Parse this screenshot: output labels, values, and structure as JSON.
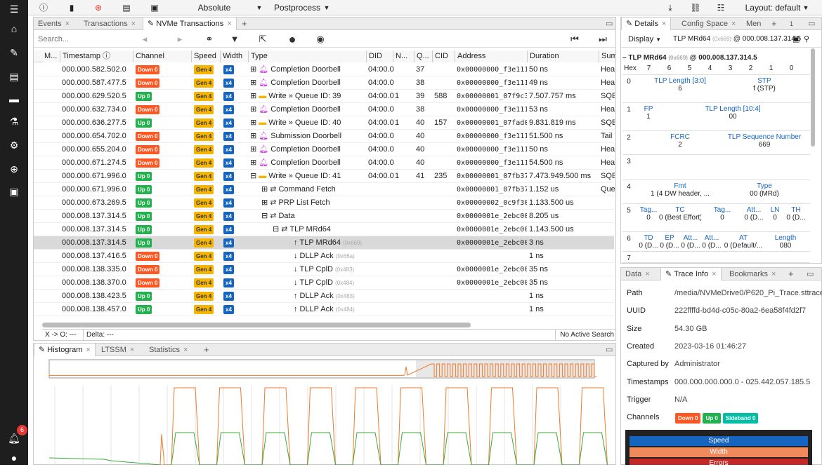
{
  "topbar": {
    "display_mode": "Absolute (Formatted)",
    "postprocess": "Postprocess",
    "layout": "Layout: default"
  },
  "sidebar": {
    "notification_count": "6"
  },
  "main_tabs": [
    {
      "label": "Events"
    },
    {
      "label": "Transactions"
    },
    {
      "label": "NVMe Transactions"
    }
  ],
  "toolbar": {
    "search_placeholder": "Search..."
  },
  "columns": [
    "M...",
    "Timestamp",
    "Channel",
    "Speed",
    "Width",
    "Type",
    "DID",
    "N...",
    "Q...",
    "CID",
    "Address",
    "Duration",
    "Sumr"
  ],
  "rows": [
    {
      "ts": "000.000.582.502.0",
      "ch": "Down 0",
      "dir": "down",
      "sp": "Gen 4",
      "w": "x4",
      "indent": 0,
      "exp": "⊞",
      "icon": "bell",
      "type": "Completion Doorbell",
      "typesub": "",
      "did": "04:00.0",
      "n": "",
      "q": "37",
      "cid": "",
      "addr": "0x00000000_f3e1112",
      "dur": "50 ns",
      "sum": "Heac"
    },
    {
      "ts": "000.000.587.477.5",
      "ch": "Down 0",
      "dir": "down",
      "sp": "Gen 4",
      "w": "x4",
      "indent": 0,
      "exp": "⊞",
      "icon": "bell",
      "type": "Completion Doorbell",
      "typesub": "",
      "did": "04:00.0",
      "n": "",
      "q": "38",
      "cid": "",
      "addr": "0x00000000_f3e1113",
      "dur": "49 ns",
      "sum": "Heac"
    },
    {
      "ts": "000.000.629.520.5",
      "ch": "Up 0",
      "dir": "up",
      "sp": "Gen 4",
      "w": "x4",
      "indent": 0,
      "exp": "⊞",
      "icon": "folder",
      "type": "Write » Queue ID: 39",
      "typesub": "",
      "did": "04:00.0",
      "n": "1",
      "q": "39",
      "cid": "588",
      "addr": "0x00000001_07f9c3",
      "dur": "7.507.757 ms",
      "sum": "SQE:"
    },
    {
      "ts": "000.000.632.734.0",
      "ch": "Down 0",
      "dir": "down",
      "sp": "Gen 4",
      "w": "x4",
      "indent": 0,
      "exp": "⊞",
      "icon": "bell",
      "type": "Completion Doorbell",
      "typesub": "",
      "did": "04:00.0",
      "n": "",
      "q": "38",
      "cid": "",
      "addr": "0x00000000_f3e1113",
      "dur": "53 ns",
      "sum": "Heac"
    },
    {
      "ts": "000.000.636.277.5",
      "ch": "Up 0",
      "dir": "up",
      "sp": "Gen 4",
      "w": "x4",
      "indent": 0,
      "exp": "⊞",
      "icon": "folder",
      "type": "Write » Queue ID: 40",
      "typesub": "",
      "did": "04:00.0",
      "n": "1",
      "q": "40",
      "cid": "157",
      "addr": "0x00000001_07fad0",
      "dur": "9.831.819 ms",
      "sum": "SQE:"
    },
    {
      "ts": "000.000.654.702.0",
      "ch": "Down 0",
      "dir": "down",
      "sp": "Gen 4",
      "w": "x4",
      "indent": 0,
      "exp": "⊞",
      "icon": "bell",
      "type": "Submission Doorbell",
      "typesub": "",
      "did": "04:00.0",
      "n": "",
      "q": "40",
      "cid": "",
      "addr": "0x00000000_f3e1114",
      "dur": "51.500 ns",
      "sum": "Tail P"
    },
    {
      "ts": "000.000.655.204.0",
      "ch": "Down 0",
      "dir": "down",
      "sp": "Gen 4",
      "w": "x4",
      "indent": 0,
      "exp": "⊞",
      "icon": "bell",
      "type": "Completion Doorbell",
      "typesub": "",
      "did": "04:00.0",
      "n": "",
      "q": "40",
      "cid": "",
      "addr": "0x00000000_f3e1114",
      "dur": "50 ns",
      "sum": "Heac"
    },
    {
      "ts": "000.000.671.274.5",
      "ch": "Down 0",
      "dir": "down",
      "sp": "Gen 4",
      "w": "x4",
      "indent": 0,
      "exp": "⊞",
      "icon": "bell",
      "type": "Completion Doorbell",
      "typesub": "",
      "did": "04:00.0",
      "n": "",
      "q": "40",
      "cid": "",
      "addr": "0x00000000_f3e1114",
      "dur": "54.500 ns",
      "sum": "Heac"
    },
    {
      "ts": "000.000.671.996.0",
      "ch": "Up 0",
      "dir": "up",
      "sp": "Gen 4",
      "w": "x4",
      "indent": 0,
      "exp": "⊟",
      "icon": "folder",
      "type": "Write » Queue ID: 41",
      "typesub": "",
      "did": "04:00.0",
      "n": "1",
      "q": "41",
      "cid": "235",
      "addr": "0x00000001_07fb37",
      "dur": "7.473.949.500 ms",
      "sum": "SQE:"
    },
    {
      "ts": "000.000.671.996.0",
      "ch": "Up 0",
      "dir": "up",
      "sp": "Gen 4",
      "w": "x4",
      "indent": 1,
      "exp": "⊞",
      "icon": "arrows",
      "type": "Command Fetch",
      "typesub": "",
      "did": "",
      "n": "",
      "q": "",
      "cid": "",
      "addr": "0x00000001_07fb37",
      "dur": "1.152 us",
      "sum": "Queu"
    },
    {
      "ts": "000.000.673.269.5",
      "ch": "Up 0",
      "dir": "up",
      "sp": "Gen 4",
      "w": "x4",
      "indent": 1,
      "exp": "⊞",
      "icon": "arrows",
      "type": "PRP List Fetch",
      "typesub": "",
      "did": "",
      "n": "",
      "q": "",
      "cid": "",
      "addr": "0x00000002_0c9f30",
      "dur": "1.133.500 us",
      "sum": ""
    },
    {
      "ts": "000.008.137.314.5",
      "ch": "Up 0",
      "dir": "up",
      "sp": "Gen 4",
      "w": "x4",
      "indent": 1,
      "exp": "⊟",
      "icon": "arrows",
      "type": "Data",
      "typesub": "",
      "did": "",
      "n": "",
      "q": "",
      "cid": "",
      "addr": "0x0000001e_2ebc00",
      "dur": "8.205 us",
      "sum": ""
    },
    {
      "ts": "000.008.137.314.5",
      "ch": "Up 0",
      "dir": "up",
      "sp": "Gen 4",
      "w": "x4",
      "indent": 2,
      "exp": "⊟",
      "icon": "arrows",
      "type": "TLP MRd64",
      "typesub": "",
      "did": "",
      "n": "",
      "q": "",
      "cid": "",
      "addr": "0x0000001e_2ebc00",
      "dur": "1.143.500 us",
      "sum": ""
    },
    {
      "ts": "000.008.137.314.5",
      "ch": "Up 0",
      "dir": "up",
      "sp": "Gen 4",
      "w": "x4",
      "indent": 3,
      "exp": "",
      "icon": "up",
      "type": "TLP MRd64",
      "typesub": "(0x669)",
      "did": "",
      "n": "",
      "q": "",
      "cid": "",
      "addr": "0x0000001e_2ebc00",
      "dur": "3 ns",
      "sum": "",
      "sel": true
    },
    {
      "ts": "000.008.137.416.5",
      "ch": "Down 0",
      "dir": "down",
      "sp": "Gen 4",
      "w": "x4",
      "indent": 3,
      "exp": "",
      "icon": "down",
      "type": "DLLP Ack",
      "typesub": "(0x66a)",
      "did": "",
      "n": "",
      "q": "",
      "cid": "",
      "addr": "",
      "dur": "1 ns",
      "sum": ""
    },
    {
      "ts": "000.008.138.335.0",
      "ch": "Down 0",
      "dir": "down",
      "sp": "Gen 4",
      "w": "x4",
      "indent": 3,
      "exp": "",
      "icon": "down",
      "type": "TLP CplD",
      "typesub": "(0x483)",
      "did": "",
      "n": "",
      "q": "",
      "cid": "",
      "addr": "0x0000001e_2ebc00",
      "dur": "35 ns",
      "sum": ""
    },
    {
      "ts": "000.008.138.370.0",
      "ch": "Down 0",
      "dir": "down",
      "sp": "Gen 4",
      "w": "x4",
      "indent": 3,
      "exp": "",
      "icon": "down",
      "type": "TLP CplD",
      "typesub": "(0x484)",
      "did": "",
      "n": "",
      "q": "",
      "cid": "",
      "addr": "0x0000001e_2ebc00",
      "dur": "35 ns",
      "sum": ""
    },
    {
      "ts": "000.008.138.423.5",
      "ch": "Up 0",
      "dir": "up",
      "sp": "Gen 4",
      "w": "x4",
      "indent": 3,
      "exp": "",
      "icon": "up",
      "type": "DLLP Ack",
      "typesub": "(0x483)",
      "did": "",
      "n": "",
      "q": "",
      "cid": "",
      "addr": "",
      "dur": "1 ns",
      "sum": ""
    },
    {
      "ts": "000.008.138.457.0",
      "ch": "Up 0",
      "dir": "up",
      "sp": "Gen 4",
      "w": "x4",
      "indent": 3,
      "exp": "",
      "icon": "up",
      "type": "DLLP Ack",
      "typesub": "(0x484)",
      "did": "",
      "n": "",
      "q": "",
      "cid": "",
      "addr": "",
      "dur": "1 ns",
      "sum": ""
    }
  ],
  "status": {
    "xo": "X -> O: ---",
    "delta": "Delta: ---",
    "search": "No Active Search"
  },
  "bottom_tabs": [
    {
      "label": "Histogram"
    },
    {
      "label": "LTSSM"
    },
    {
      "label": "Statistics"
    }
  ],
  "details": {
    "tabs": [
      {
        "label": "Details"
      },
      {
        "label": "Config Space"
      },
      {
        "label": "Men"
      }
    ],
    "counter": "1",
    "display": "Display",
    "header_pre": "TLP MRd64",
    "header_sub": "(0x669)",
    "header_post": "@ 000.008.137.314.5",
    "tree_title_pre": "– TLP MRd64",
    "tree_title_sub": "(0x669)",
    "tree_title_post": "@ 000.008.137.314.5",
    "hex_head": [
      "Hex",
      "7",
      "6",
      "5",
      "4",
      "3",
      "2",
      "1",
      "0"
    ],
    "rows": [
      {
        "num": "0",
        "fields": [
          {
            "n": "TLP Length [3:0]",
            "v": "6"
          },
          {
            "n": "STP",
            "v": "f (STP)"
          }
        ]
      },
      {
        "num": "1",
        "fields": [
          {
            "n": "FP",
            "v": "1"
          },
          {
            "n": "TLP Length [10:4]",
            "v": "00"
          }
        ]
      },
      {
        "num": "2",
        "fields": [
          {
            "n": "FCRC",
            "v": "2"
          },
          {
            "n": "TLP Sequence Number",
            "v": "669"
          }
        ]
      },
      {
        "num": "3",
        "fields": []
      },
      {
        "num": "4",
        "fields": [
          {
            "n": "Fmt",
            "v": "1 (4 DW header, ..."
          },
          {
            "n": "Type",
            "v": "00 (MRd)"
          }
        ]
      },
      {
        "num": "5",
        "fields": [
          {
            "n": "Tag...",
            "v": "0"
          },
          {
            "n": "TC",
            "v": "0 (Best Effort)"
          },
          {
            "n": "Tag...",
            "v": "0"
          },
          {
            "n": "Att...",
            "v": "0 (D..."
          },
          {
            "n": "LN",
            "v": "0"
          },
          {
            "n": "TH",
            "v": "0 (D..."
          }
        ]
      },
      {
        "num": "6",
        "fields": [
          {
            "n": "TD",
            "v": "0 (D..."
          },
          {
            "n": "EP",
            "v": "0 (D..."
          },
          {
            "n": "Att...",
            "v": "0 (D..."
          },
          {
            "n": "Att...",
            "v": "0 (D..."
          },
          {
            "n": "AT",
            "v": "0 (Default/..."
          },
          {
            "n": "Length",
            "v": "080"
          }
        ]
      },
      {
        "num": "7",
        "fields": []
      }
    ]
  },
  "trace": {
    "tabs": [
      {
        "label": "Data"
      },
      {
        "label": "Trace Info"
      },
      {
        "label": "Bookmarks"
      }
    ],
    "rows": [
      {
        "k": "Path",
        "v": "/media/NVMeDrive0/P620_Pi_Trace.sttrace"
      },
      {
        "k": "UUID",
        "v": "222ffffd-bd4d-c05c-80a2-6ea58f4fd2f7"
      },
      {
        "k": "Size",
        "v": "54.30 GB"
      },
      {
        "k": "Created",
        "v": "2023-03-16 01:46:27"
      },
      {
        "k": "Captured by",
        "v": "Administrator"
      },
      {
        "k": "Timestamps",
        "v": "000.000.000.000.0 - 025.442.057.185.5"
      },
      {
        "k": "Trigger",
        "v": "N/A"
      },
      {
        "k": "Channels",
        "v": ""
      }
    ],
    "channels": [
      "Down 0",
      "Up 0",
      "Sideband 0"
    ],
    "bars": [
      {
        "label": "Speed",
        "color": "#1565c0"
      },
      {
        "label": "Width",
        "color": "#f08a5d"
      },
      {
        "label": "Errors",
        "color": "#c62828"
      }
    ]
  },
  "colors": {
    "down": "#ff5722",
    "up": "#22b14c",
    "gen": "#f5b400",
    "width": "#1565c0",
    "hist_orange": "#f07a2a",
    "hist_green": "#3caa3c"
  }
}
